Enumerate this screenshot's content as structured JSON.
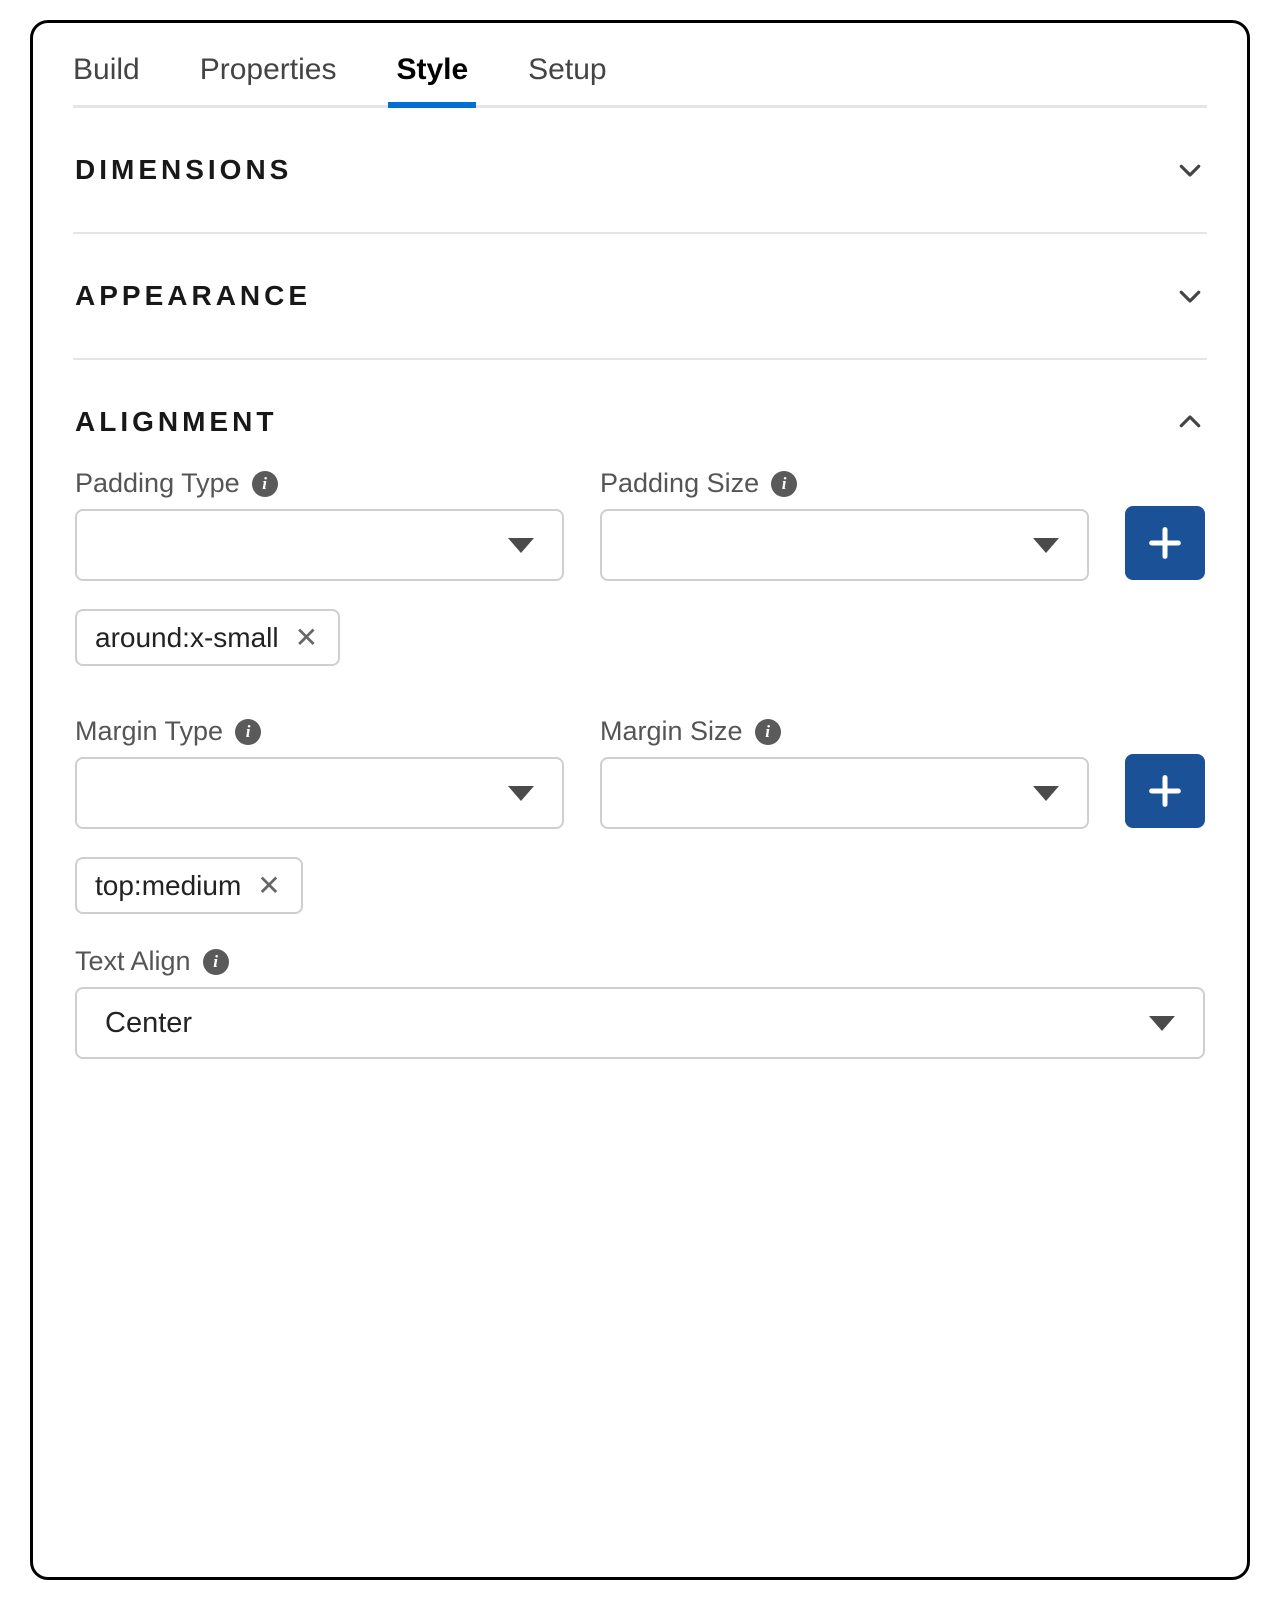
{
  "tabs": [
    {
      "label": "Build",
      "active": false
    },
    {
      "label": "Properties",
      "active": false
    },
    {
      "label": "Style",
      "active": true
    },
    {
      "label": "Setup",
      "active": false
    }
  ],
  "sections": {
    "dimensions": {
      "title": "DIMENSIONS",
      "expanded": false
    },
    "appearance": {
      "title": "APPEARANCE",
      "expanded": false
    },
    "alignment": {
      "title": "ALIGNMENT",
      "expanded": true
    }
  },
  "alignment": {
    "padding_type_label": "Padding Type",
    "padding_size_label": "Padding Size",
    "padding_type_value": "",
    "padding_size_value": "",
    "padding_chip": "around:x-small",
    "margin_type_label": "Margin Type",
    "margin_size_label": "Margin Size",
    "margin_type_value": "",
    "margin_size_value": "",
    "margin_chip": "top:medium",
    "text_align_label": "Text Align",
    "text_align_value": "Center"
  },
  "icons": {
    "info": "i"
  }
}
